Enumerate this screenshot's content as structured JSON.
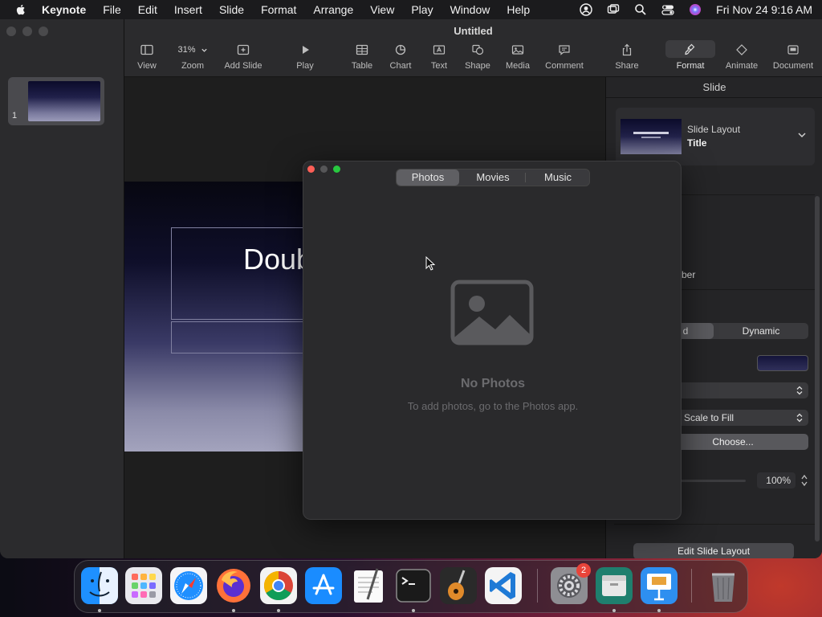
{
  "menubar": {
    "app": "Keynote",
    "items": [
      "File",
      "Edit",
      "Insert",
      "Slide",
      "Format",
      "Arrange",
      "View",
      "Play",
      "Window",
      "Help"
    ],
    "clock": "Fri Nov 24  9:16 AM"
  },
  "window": {
    "title": "Untitled"
  },
  "toolbar": {
    "zoom_value": "31%",
    "view": "View",
    "zoom": "Zoom",
    "add_slide": "Add Slide",
    "play": "Play",
    "table": "Table",
    "chart": "Chart",
    "text": "Text",
    "shape": "Shape",
    "media": "Media",
    "comment": "Comment",
    "share": "Share",
    "format": "Format",
    "animate": "Animate",
    "document": "Document"
  },
  "navigator": {
    "slide_number": "1"
  },
  "slide": {
    "title_partial": "Doub"
  },
  "inspector": {
    "header": "Slide",
    "layout_label": "Slide Layout",
    "layout_value": "Title",
    "number_partial": "ber",
    "seg_left_partial": "d",
    "seg_right": "Dynamic",
    "fill_mode": "Scale to Fill",
    "choose": "Choose...",
    "opacity": "100%",
    "edit_layout": "Edit Slide Layout"
  },
  "media_browser": {
    "tabs": [
      "Photos",
      "Movies",
      "Music"
    ],
    "active_tab": "Photos",
    "empty_title": "No Photos",
    "empty_subtitle": "To add photos, go to the Photos app."
  },
  "dock": {
    "apps": [
      "Finder",
      "Launchpad",
      "Safari",
      "Firefox",
      "Chrome",
      "App Store",
      "TextEdit",
      "Terminal",
      "GarageBand",
      "Visual Studio Code",
      "System Settings",
      "Archive",
      "Keynote",
      "Trash"
    ],
    "settings_badge": "2"
  }
}
